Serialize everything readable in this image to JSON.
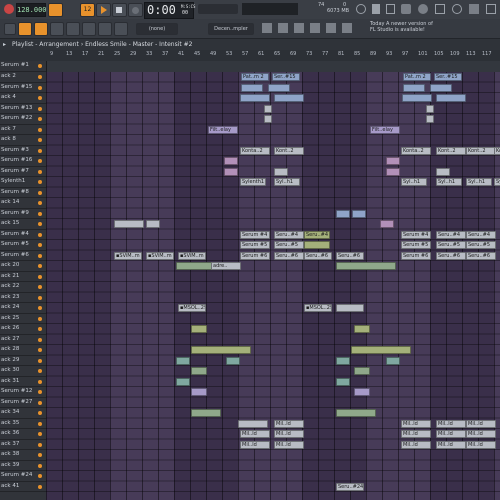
{
  "toolbar": {
    "tempo": "128.000",
    "pattern_num": "12",
    "time_display": "0:00",
    "time_sub": "00",
    "time_label": "M:S:CS",
    "cpu": "74",
    "memory": "6073 MB",
    "voices": "0",
    "pattern_selector": "(none)",
    "channel_selector": "Decen..mpler",
    "news_line1": "Today  A newer version of",
    "news_line2": "FL Studio is available!"
  },
  "playlist": {
    "breadcrumb": "Playlist - Arrangement › Endless Smile - Master - Intensit #2",
    "ruler_ticks": [
      "9",
      "13",
      "17",
      "21",
      "25",
      "29",
      "33",
      "37",
      "41",
      "45",
      "49",
      "53",
      "57",
      "61",
      "65",
      "69",
      "73",
      "77",
      "81",
      "85",
      "89",
      "93",
      "97",
      "101",
      "105",
      "109",
      "113",
      "117"
    ],
    "first_track_label": "Serum #1"
  },
  "tracks": [
    "ack 2",
    "Serum #15",
    "ack 4",
    "Serum #13",
    "Serum #22",
    "ack 7",
    "ack 8",
    "Serum #3",
    "Serum #16",
    "Serum #7",
    "Sylenth1",
    "Serum #8",
    "ack 14",
    "Serum #9",
    "ack 15",
    "Serum #4",
    "Serum #5",
    "Serum #6",
    "ack 20",
    "ack 21",
    "ack 22",
    "ack 23",
    "ack 24",
    "ack 25",
    "ack 26",
    "ack 27",
    "ack 28",
    "ack 29",
    "ack 30",
    "ack 31",
    "Serum #12",
    "Serum #27",
    "ack 34",
    "ack 35",
    "ack 36",
    "ack 37",
    "ack 38",
    "ack 39",
    "Serum #24",
    "ack 41"
  ],
  "clip_labels": {
    "pat_m2": "Pat..m 2",
    "ser15": "Ser..#15",
    "filt": "Filt..elay",
    "konta2": "Konta..2",
    "kont2": "Kont..2",
    "sylenth1": "Sylenth1",
    "syl_h1": "Syl..h1",
    "serum4": "Serum #4",
    "seru4": "Seru..#4",
    "serum5": "Serum #5",
    "seru5": "Seru..#5",
    "serum6": "Serum #6",
    "seru6": "Seru..#6",
    "svim": "▪SViM..m",
    "adre": "adre..",
    "msol": "▪MSOL..29",
    "mil": "Mil..ld",
    "seru24": "Seru..#24"
  },
  "colors": {
    "grid_bg": "#3a2f4a",
    "accent": "#e8922c",
    "toolbar": "#3a3e45"
  }
}
